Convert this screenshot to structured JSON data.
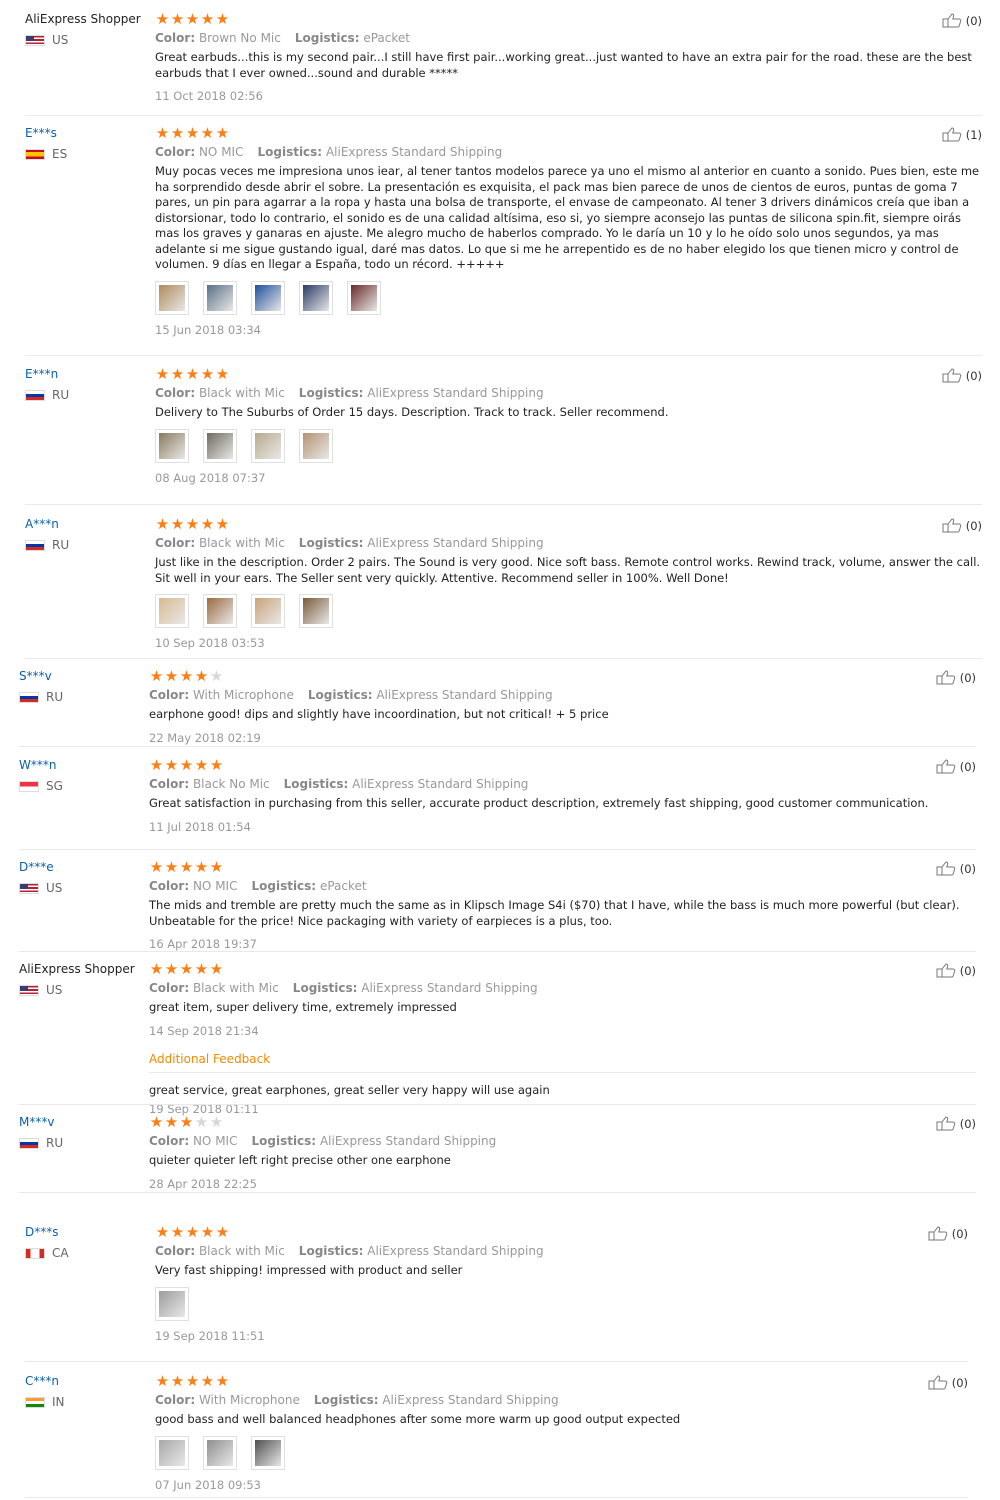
{
  "colors": {
    "star": "#fd7e14",
    "star_off": "#d8d8d8",
    "username": "#0a5fad",
    "additional_feedback": "#f08a00"
  },
  "labels": {
    "color": "Color:",
    "logistics": "Logistics:"
  },
  "reviews": [
    {
      "user": "AliExpress Shopper",
      "shopper": true,
      "country": "US",
      "rating": 5,
      "color": "Brown No Mic",
      "logistics": "ePacket",
      "text": "Great earbuds...this is my second pair...I still have first pair...working great...just wanted to have an extra pair for the road. these are the best earbuds that I ever owned...sound and durable *****",
      "date": "11 Oct 2018 02:56",
      "likes": "(0)",
      "photos": []
    },
    {
      "user": "E***s",
      "country": "ES",
      "rating": 5,
      "color": "NO MIC",
      "logistics": "AliExpress Standard Shipping",
      "text": "Muy pocas veces me impresiona unos iear, al tener tantos modelos parece ya uno el mismo al anterior en cuanto a sonido. Pues bien, este me ha sorprendido desde abrir el sobre. La presentación es exquisita, el pack mas bien parece de unos de cientos de euros, puntas de goma 7 pares, un pin para agarrar a la ropa y hasta una bolsa de transporte, el envase de campeonato. Al tener 3 drivers dinámicos creía que iban a distorsionar, todo lo contrario, el sonido es de una calidad altísima, eso si, yo siempre aconsejo las puntas de silicona spin.fit, siempre oirás mas los graves y ganaras en ajuste. Me alegro mucho de haberlos comprado. Yo le daría un 10 y lo he oído solo unos segundos, ya mas adelante si me sigue gustando igual, daré mas datos. Lo que si me he arrepentido es de no haber elegido los que tienen micro y control de volumen. 9 días en llegar a España, todo un récord. +++++",
      "date": "15 Jun 2018 03:34",
      "likes": "(1)",
      "photos": [
        "#b08a5a",
        "#5a6f86",
        "#1f4f9a",
        "#2b3a66",
        "#6b2a2a"
      ]
    },
    {
      "user": "E***n",
      "country": "RU",
      "rating": 5,
      "color": "Black with Mic",
      "logistics": "AliExpress Standard Shipping",
      "text": "Delivery to The Suburbs of Order 15 days. Description. Track to track. Seller recommend.",
      "date": "08 Aug 2018 07:37",
      "likes": "(0)",
      "photos": [
        "#8a7a5e",
        "#6e6a5e",
        "#b8a98d",
        "#b59272"
      ]
    },
    {
      "user": "A***n",
      "country": "RU",
      "rating": 5,
      "color": "Black with Mic",
      "logistics": "AliExpress Standard Shipping",
      "text": "Just like in the description. Order 2 pairs. The Sound is very good. Nice soft bass. Remote control works. Rewind track, volume, answer the call. Sit well in your ears. The Seller sent very quickly. Attentive. Recommend seller in 100%. Well Done!",
      "date": "10 Sep 2018 03:53",
      "likes": "(0)",
      "photos": [
        "#d9b98f",
        "#9a6a3f",
        "#caa27a",
        "#7a5a3a"
      ]
    },
    {
      "user": "S***v",
      "country": "RU",
      "rating": 4,
      "color": "With Microphone",
      "logistics": "AliExpress Standard Shipping",
      "text": "earphone good! dips and slightly have incoordination, but not critical! + 5 price",
      "date": "22 May 2018 02:19",
      "likes": "(0)",
      "photos": []
    },
    {
      "user": "W***n",
      "country": "SG",
      "rating": 5,
      "color": "Black No Mic",
      "logistics": "AliExpress Standard Shipping",
      "text": "Great satisfaction in purchasing from this seller, accurate product description, extremely fast shipping, good customer communication.",
      "date": "11 Jul 2018 01:54",
      "likes": "(0)",
      "photos": []
    },
    {
      "user": "D***e",
      "country": "US",
      "rating": 5,
      "color": "NO MIC",
      "logistics": "ePacket",
      "text": "The mids and tremble are pretty much the same as in Klipsch Image S4i ($70) that I have, while the bass is much more powerful (but clear). Unbeatable for the price! Nice packaging with variety of earpieces is a plus, too.",
      "date": "16 Apr 2018 19:37",
      "likes": "(0)",
      "photos": []
    },
    {
      "user": "AliExpress Shopper",
      "shopper": true,
      "country": "US",
      "rating": 5,
      "color": "Black with Mic",
      "logistics": "AliExpress Standard Shipping",
      "text": "great item, super delivery time, extremely impressed",
      "date": "14 Sep 2018 21:34",
      "likes": "(0)",
      "photos": [],
      "additional_label": "Additional Feedback",
      "additional_text": "great service, great earphones, great seller very happy will use again",
      "additional_date": "19 Sep 2018 01:11"
    },
    {
      "user": "M***v",
      "country": "RU",
      "rating": 3,
      "color": "NO MIC",
      "logistics": "AliExpress Standard Shipping",
      "text": "quieter quieter left right precise other one earphone",
      "date": "28 Apr 2018 22:25",
      "likes": "(0)",
      "photos": []
    },
    {
      "user": "D***s",
      "country": "CA",
      "rating": 5,
      "color": "Black with Mic",
      "logistics": "AliExpress Standard Shipping",
      "text": "Very fast shipping! impressed with product and seller",
      "date": "19 Sep 2018 11:51",
      "likes": "(0)",
      "photos": [
        "#9c9c9c"
      ]
    },
    {
      "user": "C***n",
      "country": "IN",
      "rating": 5,
      "color": "With Microphone",
      "logistics": "AliExpress Standard Shipping",
      "text": "good bass and well balanced headphones after some more warm up good output expected",
      "date": "07 Jun 2018 09:53",
      "likes": "(0)",
      "photos": [
        "#a8a8a8",
        "#8f8f8f",
        "#4f4f4f"
      ]
    }
  ]
}
